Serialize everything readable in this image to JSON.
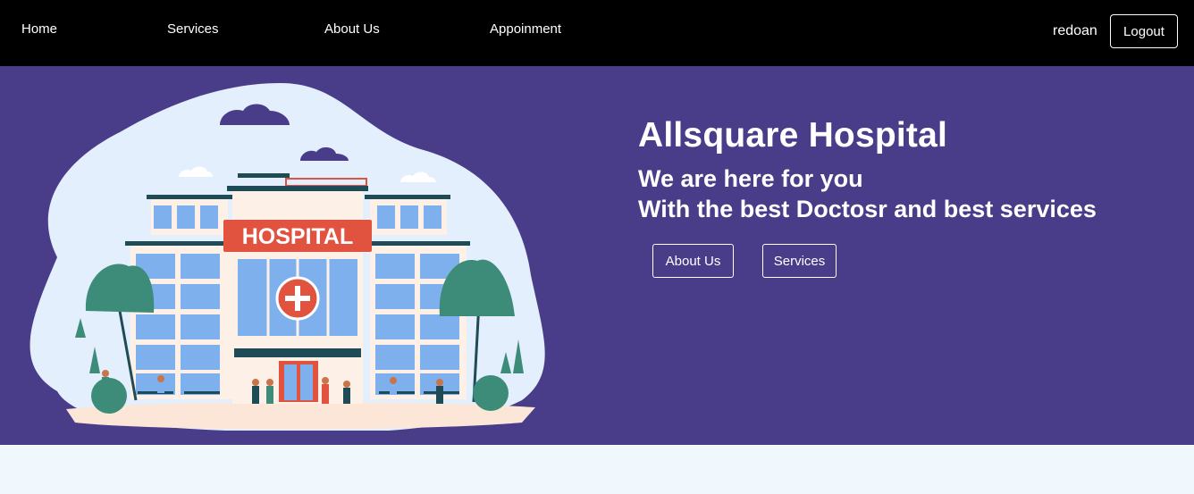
{
  "nav": {
    "links": [
      "Home",
      "Services",
      "About Us",
      "Appoinment"
    ],
    "user_name": "redoan",
    "logout_label": "Logout"
  },
  "hero": {
    "title": "Allsquare Hospital",
    "subtitle_1": "We are here for you",
    "subtitle_2": "With the best Doctosr and best services",
    "buttons": [
      "About Us",
      "Services"
    ],
    "illustration_sign": "HOSPITAL"
  },
  "colors": {
    "navbar_bg": "#000000",
    "hero_bg": "#493c89",
    "page_bg": "#f0f7fd",
    "blob": "#e4effd",
    "sign_red": "#e2533f",
    "tree_green": "#3d8c7a"
  }
}
